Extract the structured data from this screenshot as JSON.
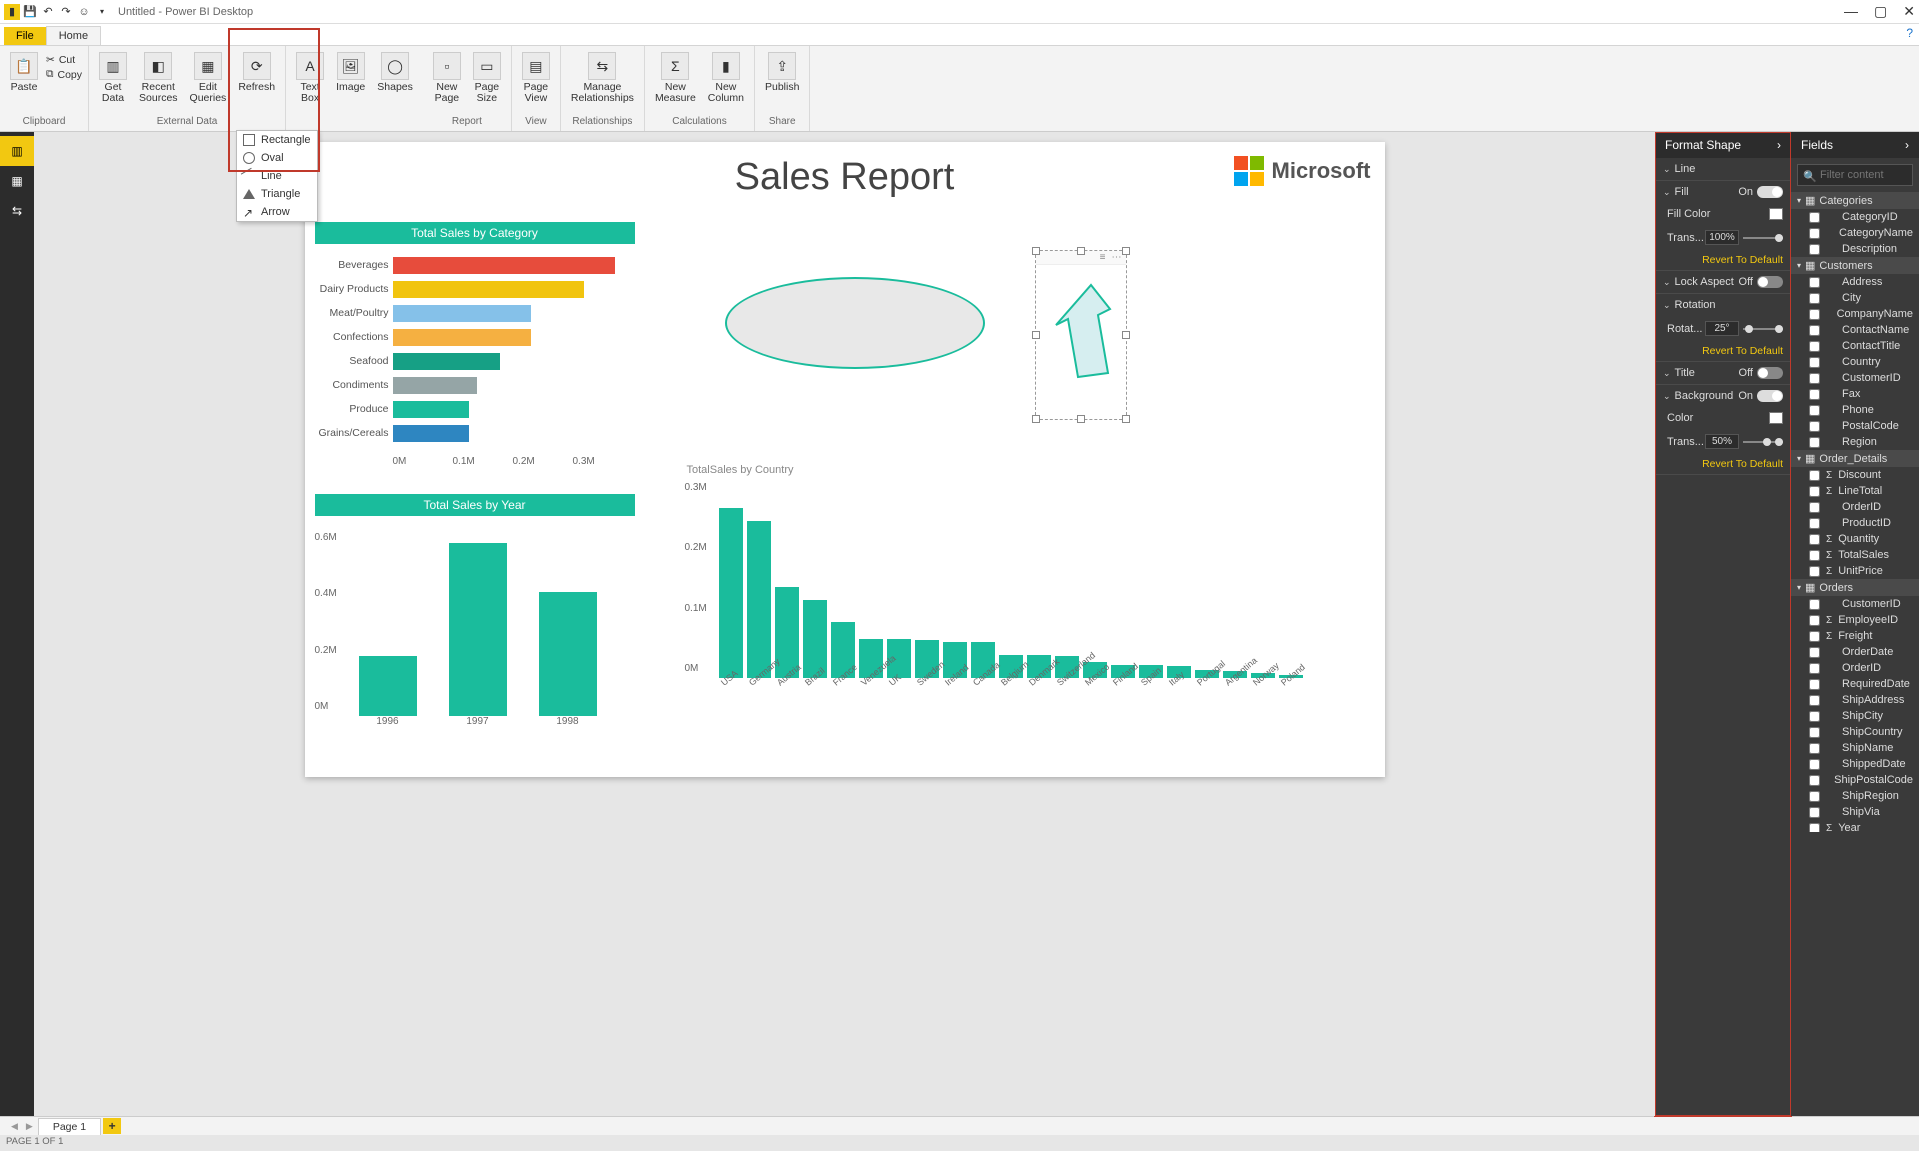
{
  "window": {
    "title": "Untitled - Power BI Desktop"
  },
  "ribbon": {
    "tabs": {
      "file": "File",
      "home": "Home"
    },
    "clipboard": {
      "paste": "Paste",
      "cut": "Cut",
      "copy": "Copy",
      "group": "Clipboard"
    },
    "external": {
      "getdata": "Get\nData",
      "recent": "Recent\nSources",
      "edit": "Edit\nQueries",
      "refresh": "Refresh",
      "group": "External Data"
    },
    "insert": {
      "textbox": "Text\nBox",
      "image": "Image",
      "shapes": "Shapes"
    },
    "report": {
      "newpage": "New\nPage",
      "pagesize": "Page\nSize",
      "group": "Report"
    },
    "view": {
      "pageview": "Page\nView",
      "group": "View"
    },
    "rel": {
      "manage": "Manage\nRelationships",
      "group": "Relationships"
    },
    "calc": {
      "newmeasure": "New\nMeasure",
      "newcolumn": "New\nColumn",
      "group": "Calculations"
    },
    "share": {
      "publish": "Publish",
      "group": "Share"
    },
    "shapes_menu": [
      "Rectangle",
      "Oval",
      "Line",
      "Triangle",
      "Arrow"
    ]
  },
  "report": {
    "title": "Sales Report",
    "ms": "Microsoft"
  },
  "chart_data": [
    {
      "type": "bar",
      "orientation": "horizontal",
      "title": "Total Sales by Category",
      "categories": [
        "Beverages",
        "Dairy Products",
        "Meat/Poultry",
        "Confections",
        "Seafood",
        "Condiments",
        "Produce",
        "Grains/Cereals"
      ],
      "values": [
        0.29,
        0.25,
        0.18,
        0.18,
        0.14,
        0.11,
        0.1,
        0.1
      ],
      "colors": [
        "#e74c3c",
        "#f1c40f",
        "#85c1e9",
        "#f5b041",
        "#16a085",
        "#95a5a6",
        "#1abc9c",
        "#2e86c1"
      ],
      "xlabel": "",
      "ylabel": "",
      "xticks": [
        "0M",
        "0.1M",
        "0.2M",
        "0.3M"
      ],
      "xlim": [
        0,
        0.3
      ]
    },
    {
      "type": "bar",
      "title": "Total Sales by Year",
      "categories": [
        "1996",
        "1997",
        "1998"
      ],
      "values": [
        0.23,
        0.66,
        0.47
      ],
      "yticks": [
        "0.6M",
        "0.4M",
        "0.2M",
        "0M"
      ],
      "ylim": [
        0,
        0.7
      ]
    },
    {
      "type": "bar",
      "title": "TotalSales by Country",
      "categories": [
        "USA",
        "Germany",
        "Austria",
        "Brazil",
        "France",
        "Venezuela",
        "UK",
        "Sweden",
        "Ireland",
        "Canada",
        "Belgium",
        "Denmark",
        "Switzerland",
        "Mexico",
        "Finland",
        "Spain",
        "Italy",
        "Portugal",
        "Argentina",
        "Norway",
        "Poland"
      ],
      "values": [
        0.26,
        0.24,
        0.14,
        0.12,
        0.085,
        0.06,
        0.06,
        0.058,
        0.055,
        0.055,
        0.035,
        0.035,
        0.033,
        0.025,
        0.02,
        0.02,
        0.018,
        0.013,
        0.01,
        0.008,
        0.005
      ],
      "yticks": [
        "0.3M",
        "0.2M",
        "0.1M",
        "0M"
      ],
      "ylim": [
        0,
        0.3
      ]
    }
  ],
  "format_shape": {
    "title": "Format Shape",
    "sections": {
      "line": "Line",
      "fill": "Fill",
      "fill_on": "On",
      "fillcolor": "Fill Color",
      "trans": "Trans...",
      "trans_val": "100%",
      "revert": "Revert To Default",
      "lockaspect": "Lock Aspect",
      "lock_off": "Off",
      "rotation": "Rotation",
      "rotat": "Rotat...",
      "rotat_val": "25°",
      "title_sec": "Title",
      "title_off": "Off",
      "background": "Background",
      "bg_on": "On",
      "color": "Color",
      "bg_trans_val": "50%"
    }
  },
  "fields": {
    "title": "Fields",
    "filter_placeholder": "Filter content",
    "tables": {
      "Categories": [
        "CategoryID",
        "CategoryName",
        "Description"
      ],
      "Customers": [
        "Address",
        "City",
        "CompanyName",
        "ContactName",
        "ContactTitle",
        "Country",
        "CustomerID",
        "Fax",
        "Phone",
        "PostalCode",
        "Region"
      ],
      "Order_Details": [
        "Discount",
        "LineTotal",
        "OrderID",
        "ProductID",
        "Quantity",
        "TotalSales",
        "UnitPrice"
      ],
      "Orders": [
        "CustomerID",
        "EmployeeID",
        "Freight",
        "OrderDate",
        "OrderID",
        "RequiredDate",
        "ShipAddress",
        "ShipCity",
        "ShipCountry",
        "ShipName",
        "ShippedDate",
        "ShipPostalCode",
        "ShipRegion",
        "ShipVia",
        "Year"
      ]
    }
  },
  "pagetabs": {
    "page1": "Page 1"
  },
  "status": "PAGE 1 OF 1"
}
